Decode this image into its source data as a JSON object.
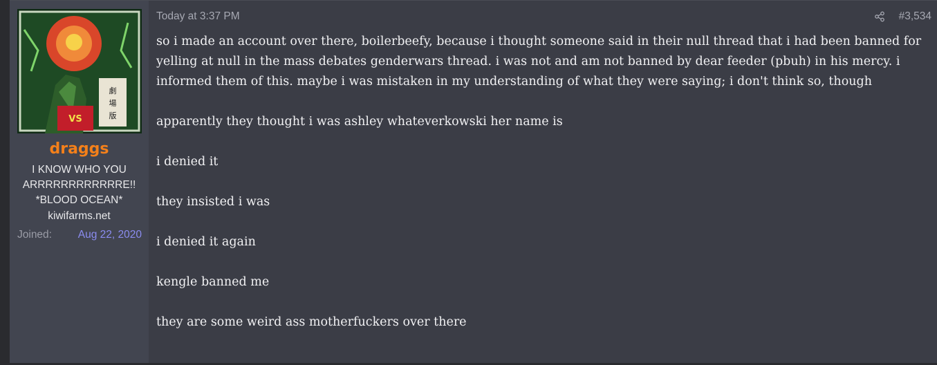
{
  "user": {
    "username": "draggs",
    "title_line1": "I KNOW WHO YOU",
    "title_line2": "ARRRRRRRRRRRRE!!",
    "title_line3": "*BLOOD OCEAN*",
    "site": "kiwifarms.net",
    "joined_label": "Joined:",
    "joined_date": "Aug 22, 2020",
    "avatar_icon": "godzilla-vs-biollante-poster"
  },
  "post": {
    "time": "Today at 3:37 PM",
    "share_icon": "share-icon",
    "number": "#3,534",
    "paragraphs": [
      "so i made an account over there, boilerbeefy, because i thought someone said in their null thread that i had been banned for yelling at null in the mass debates genderwars thread. i was not and am not banned by dear feeder (pbuh) in his mercy. i informed them of this. maybe i was mistaken in my understanding of what they were saying; i don't think so, though",
      "apparently they thought i was ashley whateverkowski her name is",
      "i denied it",
      "they insisted i was",
      "i denied it again",
      "kengle banned me",
      "they are some weird ass motherfuckers over there"
    ]
  },
  "colors": {
    "page_bg": "#2a2b2f",
    "message_bg": "#3b3d46",
    "user_cell_bg": "#424550",
    "username": "#f4801a",
    "joined_date": "#8b8cf0",
    "text": "#f1f1f3",
    "muted": "#a6a8b2"
  }
}
